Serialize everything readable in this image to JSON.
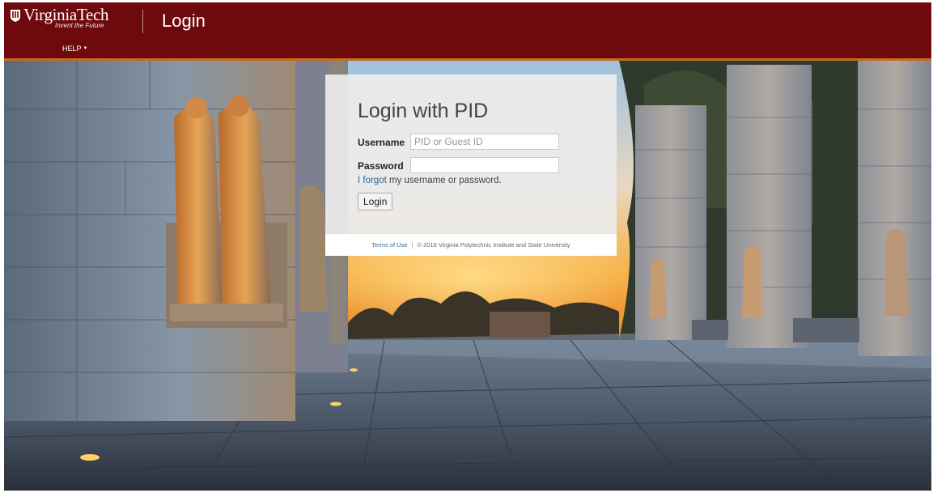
{
  "header": {
    "logo_word": "VirginiaTech",
    "logo_tagline": "Invent the Future",
    "title": "Login",
    "help_label": "HELP",
    "help_icon": "caret-down-icon",
    "bar_color": "#6e0a0d",
    "accent_color": "#c86a1a"
  },
  "login": {
    "title": "Login with PID",
    "username_label": "Username",
    "username_placeholder": "PID or Guest ID",
    "username_value": "",
    "password_label": "Password",
    "password_value": "",
    "forgot_link": "I forgot",
    "forgot_rest": " my username or password.",
    "submit_label": "Login"
  },
  "footer": {
    "terms_label": "Terms of Use",
    "separator": "|",
    "copyright": "© 2016 Virginia Polytechnic Institute and State University"
  }
}
